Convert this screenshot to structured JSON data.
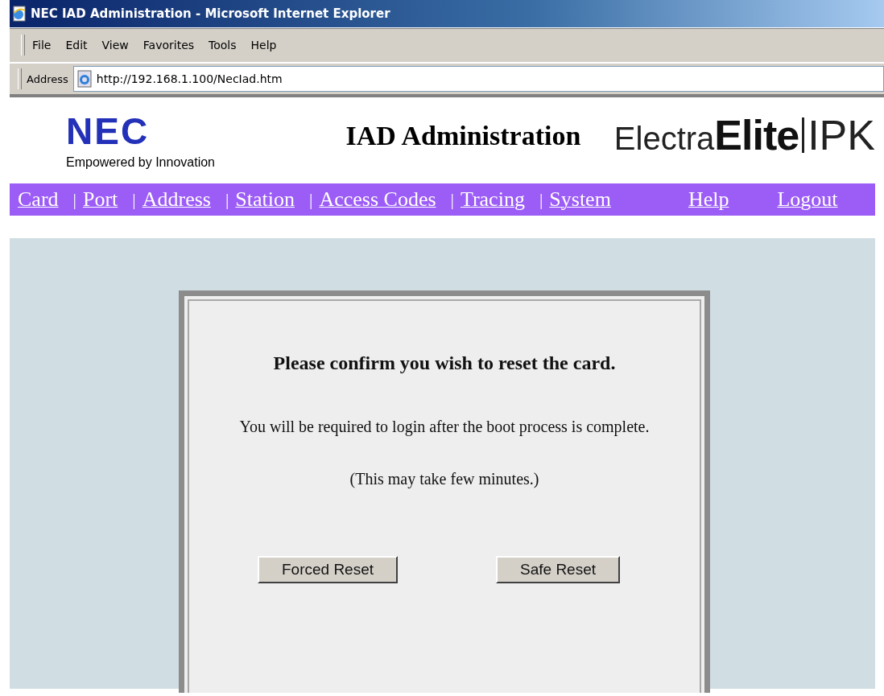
{
  "window": {
    "title": "NEC IAD Administration - Microsoft Internet Explorer"
  },
  "menu_bar": [
    "File",
    "Edit",
    "View",
    "Favorites",
    "Tools",
    "Help"
  ],
  "address_bar": {
    "label": "Address",
    "value": "http://192.168.1.100/NecIad.htm"
  },
  "header": {
    "logo": "NEC",
    "tagline": "Empowered by Innovation",
    "title": "IAD Administration",
    "product": [
      "Electra",
      "Elite",
      "IPK"
    ]
  },
  "nav": [
    {
      "label": "Card"
    },
    {
      "label": "Port",
      "separator": "|"
    },
    {
      "label": "Address",
      "separator": "|"
    },
    {
      "label": "Station",
      "separator": "|"
    },
    {
      "label": "Access Codes",
      "separator": "|"
    },
    {
      "label": "Tracing",
      "separator": "|"
    },
    {
      "label": "System",
      "separator": "|"
    },
    {
      "label": "Help"
    },
    {
      "label": "Logout"
    }
  ],
  "dialog": {
    "heading": "Please confirm you wish to reset the card.",
    "message": "You will be required to login after the boot process is complete.",
    "note": "(This may take few minutes.)",
    "buttons": [
      "Forced Reset",
      "Safe Reset"
    ]
  }
}
